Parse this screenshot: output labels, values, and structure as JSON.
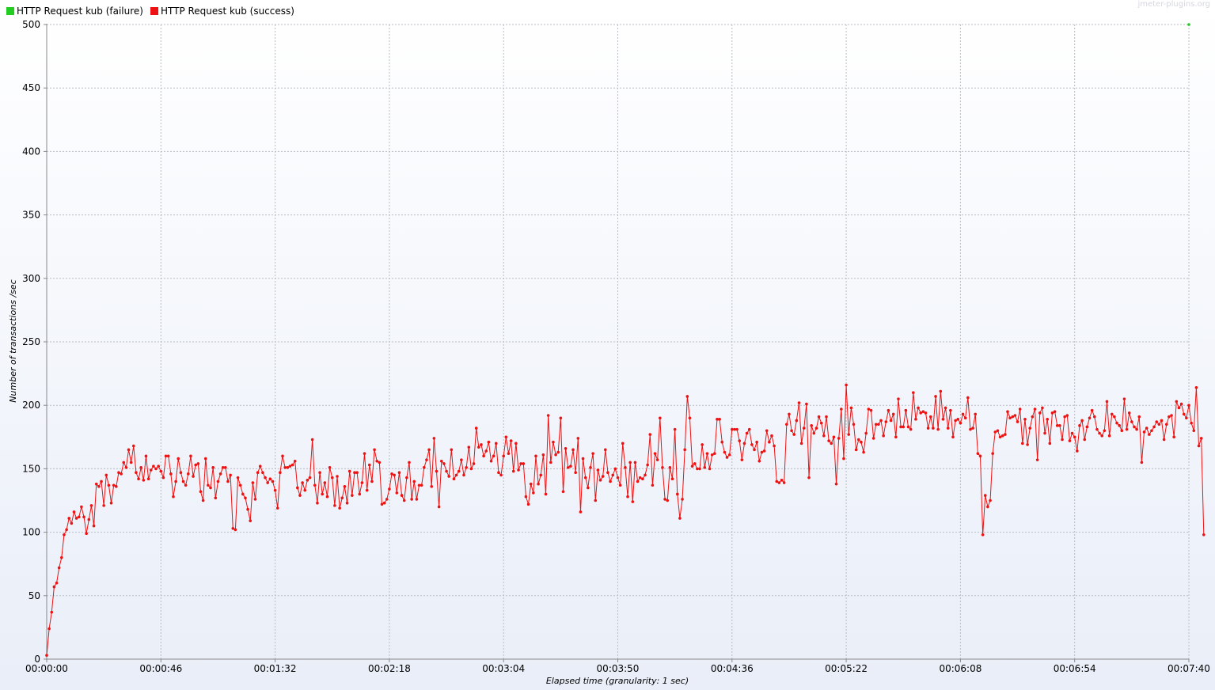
{
  "legend": {
    "failure_label": "HTTP Request kub (failure)",
    "failure_color": "#22cc22",
    "success_label": "HTTP Request kub (success)",
    "success_color": "#ee1111"
  },
  "watermark": "jmeter-plugins.org",
  "chart_data": {
    "type": "line",
    "xlabel": "Elapsed time (granularity: 1 sec)",
    "ylabel": "Number of transactions /sec",
    "ylim": [
      0,
      500
    ],
    "xlim_seconds": [
      0,
      460
    ],
    "y_ticks": [
      "0",
      "50",
      "100",
      "150",
      "200",
      "250",
      "300",
      "350",
      "400",
      "450",
      "500"
    ],
    "x_ticks": [
      "00:00:00",
      "00:00:46",
      "00:01:32",
      "00:02:18",
      "00:03:04",
      "00:03:50",
      "00:04:36",
      "00:05:22",
      "00:06:08",
      "00:06:54",
      "00:07:40"
    ],
    "grid": true,
    "legend_position": "top-left",
    "series": [
      {
        "name": "HTTP Request kub (failure)",
        "color": "#22cc22",
        "x_seconds": [
          460
        ],
        "values": [
          500
        ]
      },
      {
        "name": "HTTP Request kub (success)",
        "color": "#ee1111",
        "x_start_seconds": 0,
        "x_step_seconds": 1,
        "values": [
          3,
          24,
          37,
          57,
          60,
          72,
          80,
          98,
          102,
          111,
          107,
          116,
          111,
          112,
          120,
          112,
          99,
          110,
          121,
          105,
          138,
          136,
          140,
          121,
          145,
          137,
          123,
          137,
          136,
          147,
          146,
          155,
          151,
          165,
          155,
          168,
          147,
          142,
          151,
          141,
          160,
          142,
          149,
          152,
          150,
          152,
          148,
          143,
          160,
          160,
          146,
          128,
          140,
          158,
          147,
          140,
          137,
          146,
          160,
          144,
          153,
          154,
          132,
          125,
          158,
          137,
          135,
          151,
          127,
          140,
          146,
          151,
          151,
          140,
          145,
          103,
          102,
          143,
          137,
          130,
          127,
          118,
          109,
          139,
          126,
          147,
          152,
          147,
          143,
          139,
          142,
          140,
          133,
          119,
          147,
          160,
          151,
          151,
          152,
          153,
          156,
          135,
          129,
          139,
          133,
          141,
          143,
          173,
          137,
          123,
          147,
          130,
          139,
          128,
          151,
          143,
          121,
          144,
          119,
          127,
          136,
          123,
          148,
          129,
          147,
          147,
          130,
          139,
          162,
          133,
          153,
          140,
          165,
          156,
          155,
          122,
          123,
          126,
          134,
          146,
          145,
          131,
          147,
          129,
          125,
          143,
          155,
          126,
          140,
          126,
          137,
          137,
          151,
          157,
          165,
          136,
          174,
          148,
          120,
          156,
          154,
          148,
          144,
          165,
          142,
          145,
          148,
          157,
          145,
          151,
          167,
          150,
          154,
          182,
          167,
          169,
          160,
          164,
          171,
          156,
          160,
          170,
          147,
          145,
          160,
          175,
          162,
          172,
          148,
          170,
          149,
          154,
          154,
          128,
          122,
          138,
          131,
          160,
          138,
          145,
          161,
          130,
          192,
          155,
          171,
          161,
          163,
          190,
          132,
          166,
          151,
          152,
          165,
          147,
          174,
          116,
          158,
          143,
          135,
          151,
          162,
          125,
          149,
          141,
          144,
          165,
          147,
          140,
          145,
          150,
          143,
          137,
          170,
          151,
          128,
          155,
          124,
          155,
          140,
          143,
          142,
          145,
          153,
          177,
          137,
          162,
          157,
          190,
          151,
          126,
          125,
          151,
          142,
          181,
          130,
          111,
          126,
          165,
          207,
          190,
          152,
          154,
          150,
          150,
          169,
          151,
          162,
          150,
          161,
          162,
          189,
          189,
          171,
          163,
          159,
          161,
          181,
          181,
          181,
          172,
          157,
          170,
          178,
          181,
          169,
          165,
          171,
          156,
          163,
          164,
          180,
          171,
          176,
          168,
          140,
          139,
          141,
          139,
          185,
          193,
          180,
          177,
          188,
          202,
          170,
          182,
          201,
          143,
          184,
          178,
          182,
          191,
          186,
          176,
          191,
          172,
          170,
          175,
          138,
          174,
          197,
          158,
          216,
          177,
          198,
          185,
          165,
          173,
          171,
          163,
          178,
          197,
          196,
          174,
          185,
          185,
          188,
          176,
          187,
          196,
          188,
          193,
          175,
          205,
          183,
          183,
          196,
          183,
          181,
          210,
          189,
          198,
          194,
          195,
          194,
          182,
          191,
          182,
          207,
          181,
          211,
          189,
          198,
          182,
          196,
          175,
          188,
          189,
          186,
          193,
          190,
          206,
          181,
          182,
          193,
          162,
          160,
          98,
          129,
          120,
          125,
          162,
          179,
          180,
          175,
          176,
          177,
          195,
          190,
          191,
          192,
          187,
          197,
          170,
          189,
          169,
          182,
          191,
          197,
          157,
          194,
          198,
          178,
          189,
          170,
          194,
          195,
          184,
          184,
          173,
          191,
          192,
          172,
          178,
          175,
          164,
          184,
          188,
          173,
          183,
          190,
          196,
          191,
          181,
          178,
          176,
          180,
          203,
          176,
          193,
          191,
          186,
          184,
          180,
          205,
          181,
          194,
          187,
          183,
          181,
          191,
          155,
          179,
          182,
          177,
          180,
          183,
          187,
          185,
          188,
          173,
          185,
          191,
          192,
          175,
          203,
          198,
          201,
          193,
          190,
          200,
          186,
          180,
          214,
          168,
          174,
          98
        ]
      }
    ]
  }
}
